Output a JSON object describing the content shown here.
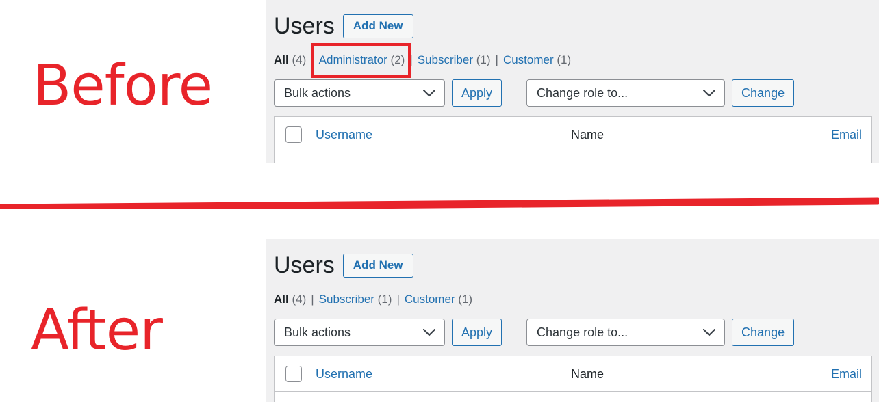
{
  "annotations": {
    "before_label": "Before",
    "after_label": "After",
    "accent_color": "#e8242a",
    "divider_icon": "red-underline-stroke"
  },
  "panels": {
    "before": {
      "header": {
        "title": "Users",
        "add_new_label": "Add New"
      },
      "filters": [
        {
          "label": "All",
          "count": "(4)",
          "current": true,
          "highlighted": false
        },
        {
          "label": "Administrator",
          "count": "(2)",
          "current": false,
          "highlighted": true
        },
        {
          "label": "Subscriber",
          "count": "(1)",
          "current": false,
          "highlighted": false
        },
        {
          "label": "Customer",
          "count": "(1)",
          "current": false,
          "highlighted": false
        }
      ],
      "separator": "|",
      "tablenav": {
        "bulk_select_value": "Bulk actions",
        "apply_label": "Apply",
        "role_select_value": "Change role to...",
        "change_label": "Change",
        "chevron_icon": "chevron-down-icon"
      },
      "table": {
        "select_all_icon": "checkbox-unchecked-icon",
        "columns": [
          "Username",
          "Name",
          "Email"
        ]
      }
    },
    "after": {
      "header": {
        "title": "Users",
        "add_new_label": "Add New"
      },
      "filters": [
        {
          "label": "All",
          "count": "(4)",
          "current": true,
          "highlighted": false
        },
        {
          "label": "Subscriber",
          "count": "(1)",
          "current": false,
          "highlighted": false
        },
        {
          "label": "Customer",
          "count": "(1)",
          "current": false,
          "highlighted": false
        }
      ],
      "separator": "|",
      "tablenav": {
        "bulk_select_value": "Bulk actions",
        "apply_label": "Apply",
        "role_select_value": "Change role to...",
        "change_label": "Change",
        "chevron_icon": "chevron-down-icon"
      },
      "table": {
        "select_all_icon": "checkbox-unchecked-icon",
        "columns": [
          "Username",
          "Name",
          "Email"
        ]
      }
    }
  }
}
